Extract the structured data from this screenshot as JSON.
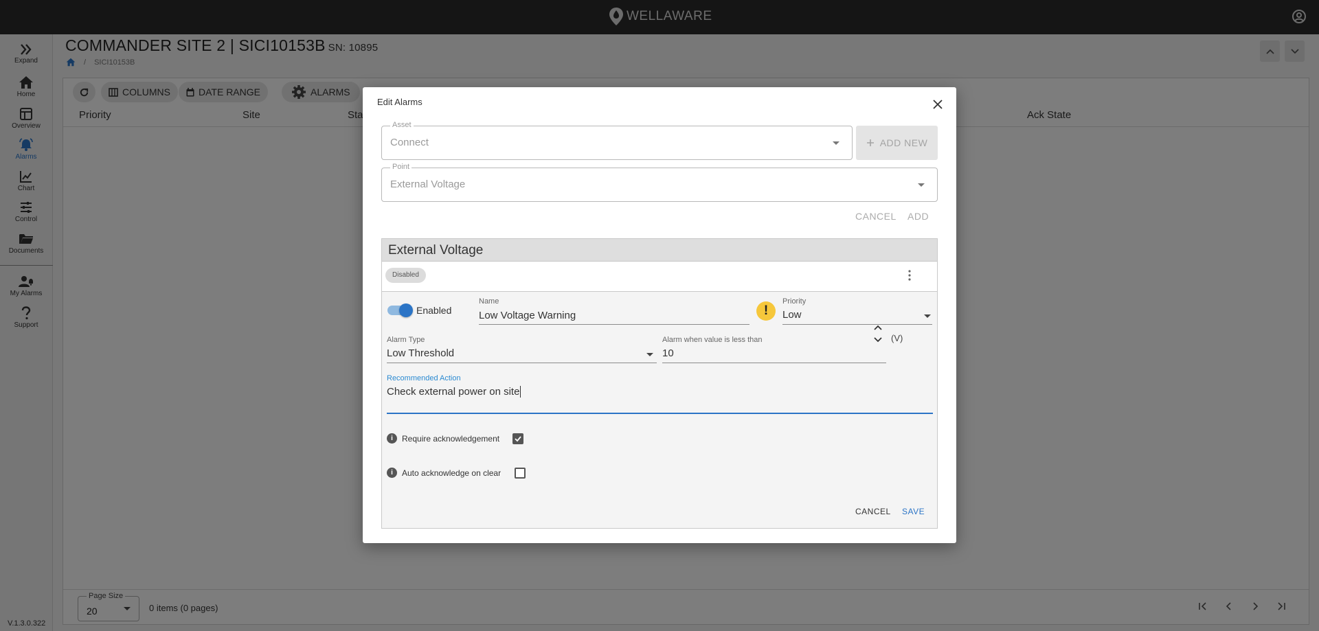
{
  "app": {
    "brand": "WELLAWARE",
    "version": "V.1.3.0.322"
  },
  "sidebar": {
    "items": [
      {
        "label": "Expand",
        "icon": "chevron-double-right-icon"
      },
      {
        "label": "Home",
        "icon": "home-icon"
      },
      {
        "label": "Overview",
        "icon": "dashboard-icon"
      },
      {
        "label": "Alarms",
        "icon": "alarm-bell-icon",
        "active": true
      },
      {
        "label": "Chart",
        "icon": "line-chart-icon"
      },
      {
        "label": "Control",
        "icon": "sliders-icon"
      },
      {
        "label": "Documents",
        "icon": "folder-icon"
      },
      {
        "label": "My Alarms",
        "icon": "user-alarm-icon"
      },
      {
        "label": "Support",
        "icon": "question-icon"
      }
    ]
  },
  "header": {
    "title": "COMMANDER SITE 2 | SICI10153B",
    "serial": "SN: 10895",
    "breadcrumb": [
      "SICI10153B"
    ]
  },
  "toolbar": {
    "refresh": "",
    "columns": "COLUMNS",
    "date_range": "DATE RANGE",
    "alarms": "ALARMS"
  },
  "table": {
    "columns": [
      "Priority",
      "Site",
      "Sta",
      "Ack State"
    ],
    "page_size_label": "Page Size",
    "page_size": "20",
    "items_summary": "0 items (0 pages)"
  },
  "modal": {
    "title": "Edit Alarms",
    "asset": {
      "label": "Asset",
      "value": "Connect"
    },
    "add_new": "ADD NEW",
    "point": {
      "label": "Point",
      "value": "External Voltage"
    },
    "cancel_top": "CANCEL",
    "add": "ADD",
    "card": {
      "title": "External Voltage",
      "status_chip": "Disabled",
      "enabled_label": "Enabled",
      "enabled": true,
      "name_label": "Name",
      "name_value": "Low Voltage Warning",
      "priority_label": "Priority",
      "priority_value": "Low",
      "alarm_type_label": "Alarm Type",
      "alarm_type_value": "Low Threshold",
      "threshold_label": "Alarm when value is less than",
      "threshold_value": "10",
      "unit": "(V)",
      "action_label": "Recommended Action",
      "action_value": "Check external power on site",
      "require_ack_label": "Require acknowledgement",
      "require_ack": true,
      "auto_ack_label": "Auto acknowledge on clear",
      "auto_ack": false,
      "cancel": "CANCEL",
      "save": "SAVE"
    }
  },
  "colors": {
    "accent": "#2b74c6",
    "topbar": "#2b2b2b",
    "warning": "#f6c73b"
  }
}
